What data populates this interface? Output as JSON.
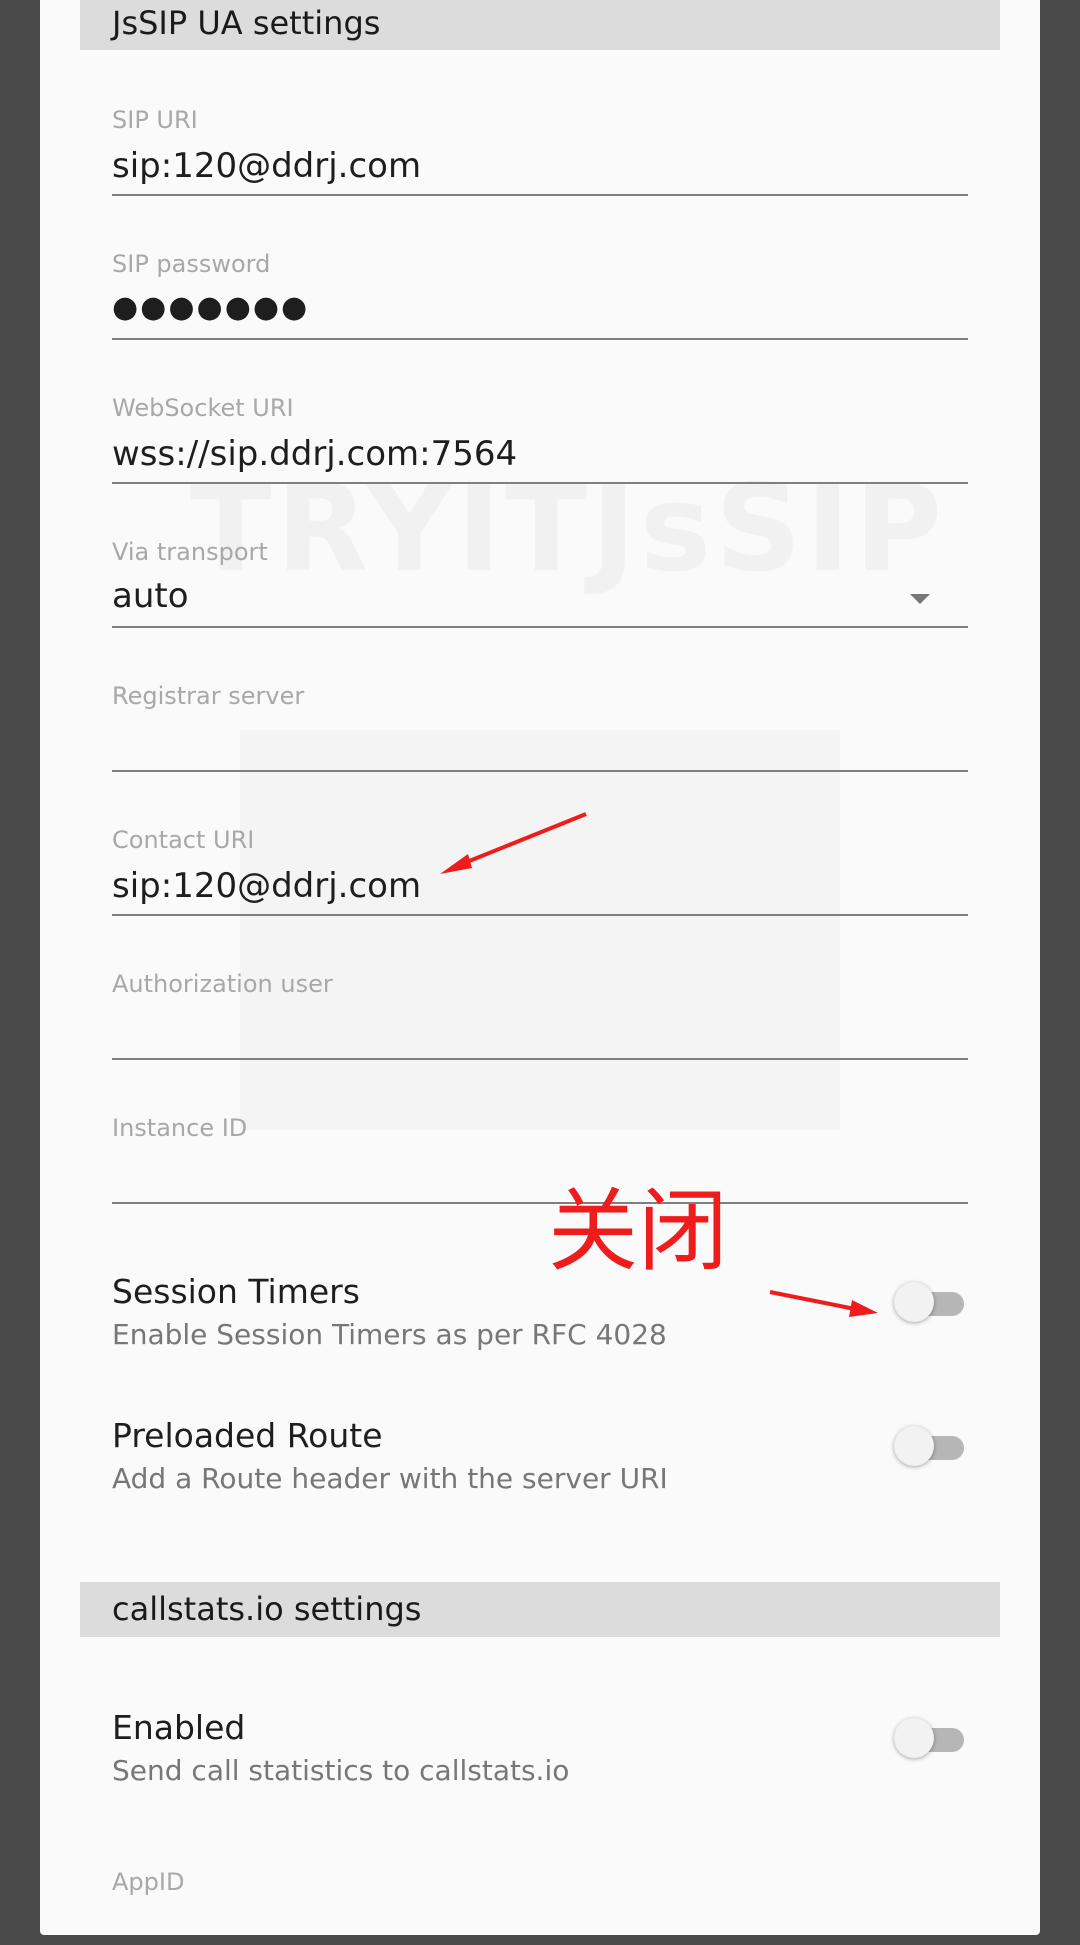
{
  "sections": {
    "jssip_header": "JsSIP UA settings",
    "callstats_header": "callstats.io settings"
  },
  "fields": {
    "sip_uri": {
      "label": "SIP URI",
      "value": "sip:120@ddrj.com"
    },
    "sip_password": {
      "label": "SIP password",
      "value": "●●●●●●●"
    },
    "websocket_uri": {
      "label": "WebSocket URI",
      "value": "wss://sip.ddrj.com:7564"
    },
    "via_transport": {
      "label": "Via transport",
      "value": "auto"
    },
    "registrar_server": {
      "label": "Registrar server",
      "value": ""
    },
    "contact_uri": {
      "label": "Contact URI",
      "value": "sip:120@ddrj.com"
    },
    "authorization_user": {
      "label": "Authorization user",
      "value": ""
    },
    "instance_id": {
      "label": "Instance ID",
      "value": ""
    },
    "app_id": {
      "label": "AppID"
    }
  },
  "toggles": {
    "session_timers": {
      "title": "Session Timers",
      "desc": "Enable Session Timers as per RFC 4028",
      "on": false
    },
    "preloaded_route": {
      "title": "Preloaded Route",
      "desc": "Add a Route header with the server URI",
      "on": false
    },
    "callstats_enabled": {
      "title": "Enabled",
      "desc": "Send call statistics to callstats.io",
      "on": false
    }
  },
  "annotation": {
    "text": "关闭",
    "color": "#ee1c1c"
  },
  "icons": {
    "dropdown": "chevron-down-icon"
  }
}
